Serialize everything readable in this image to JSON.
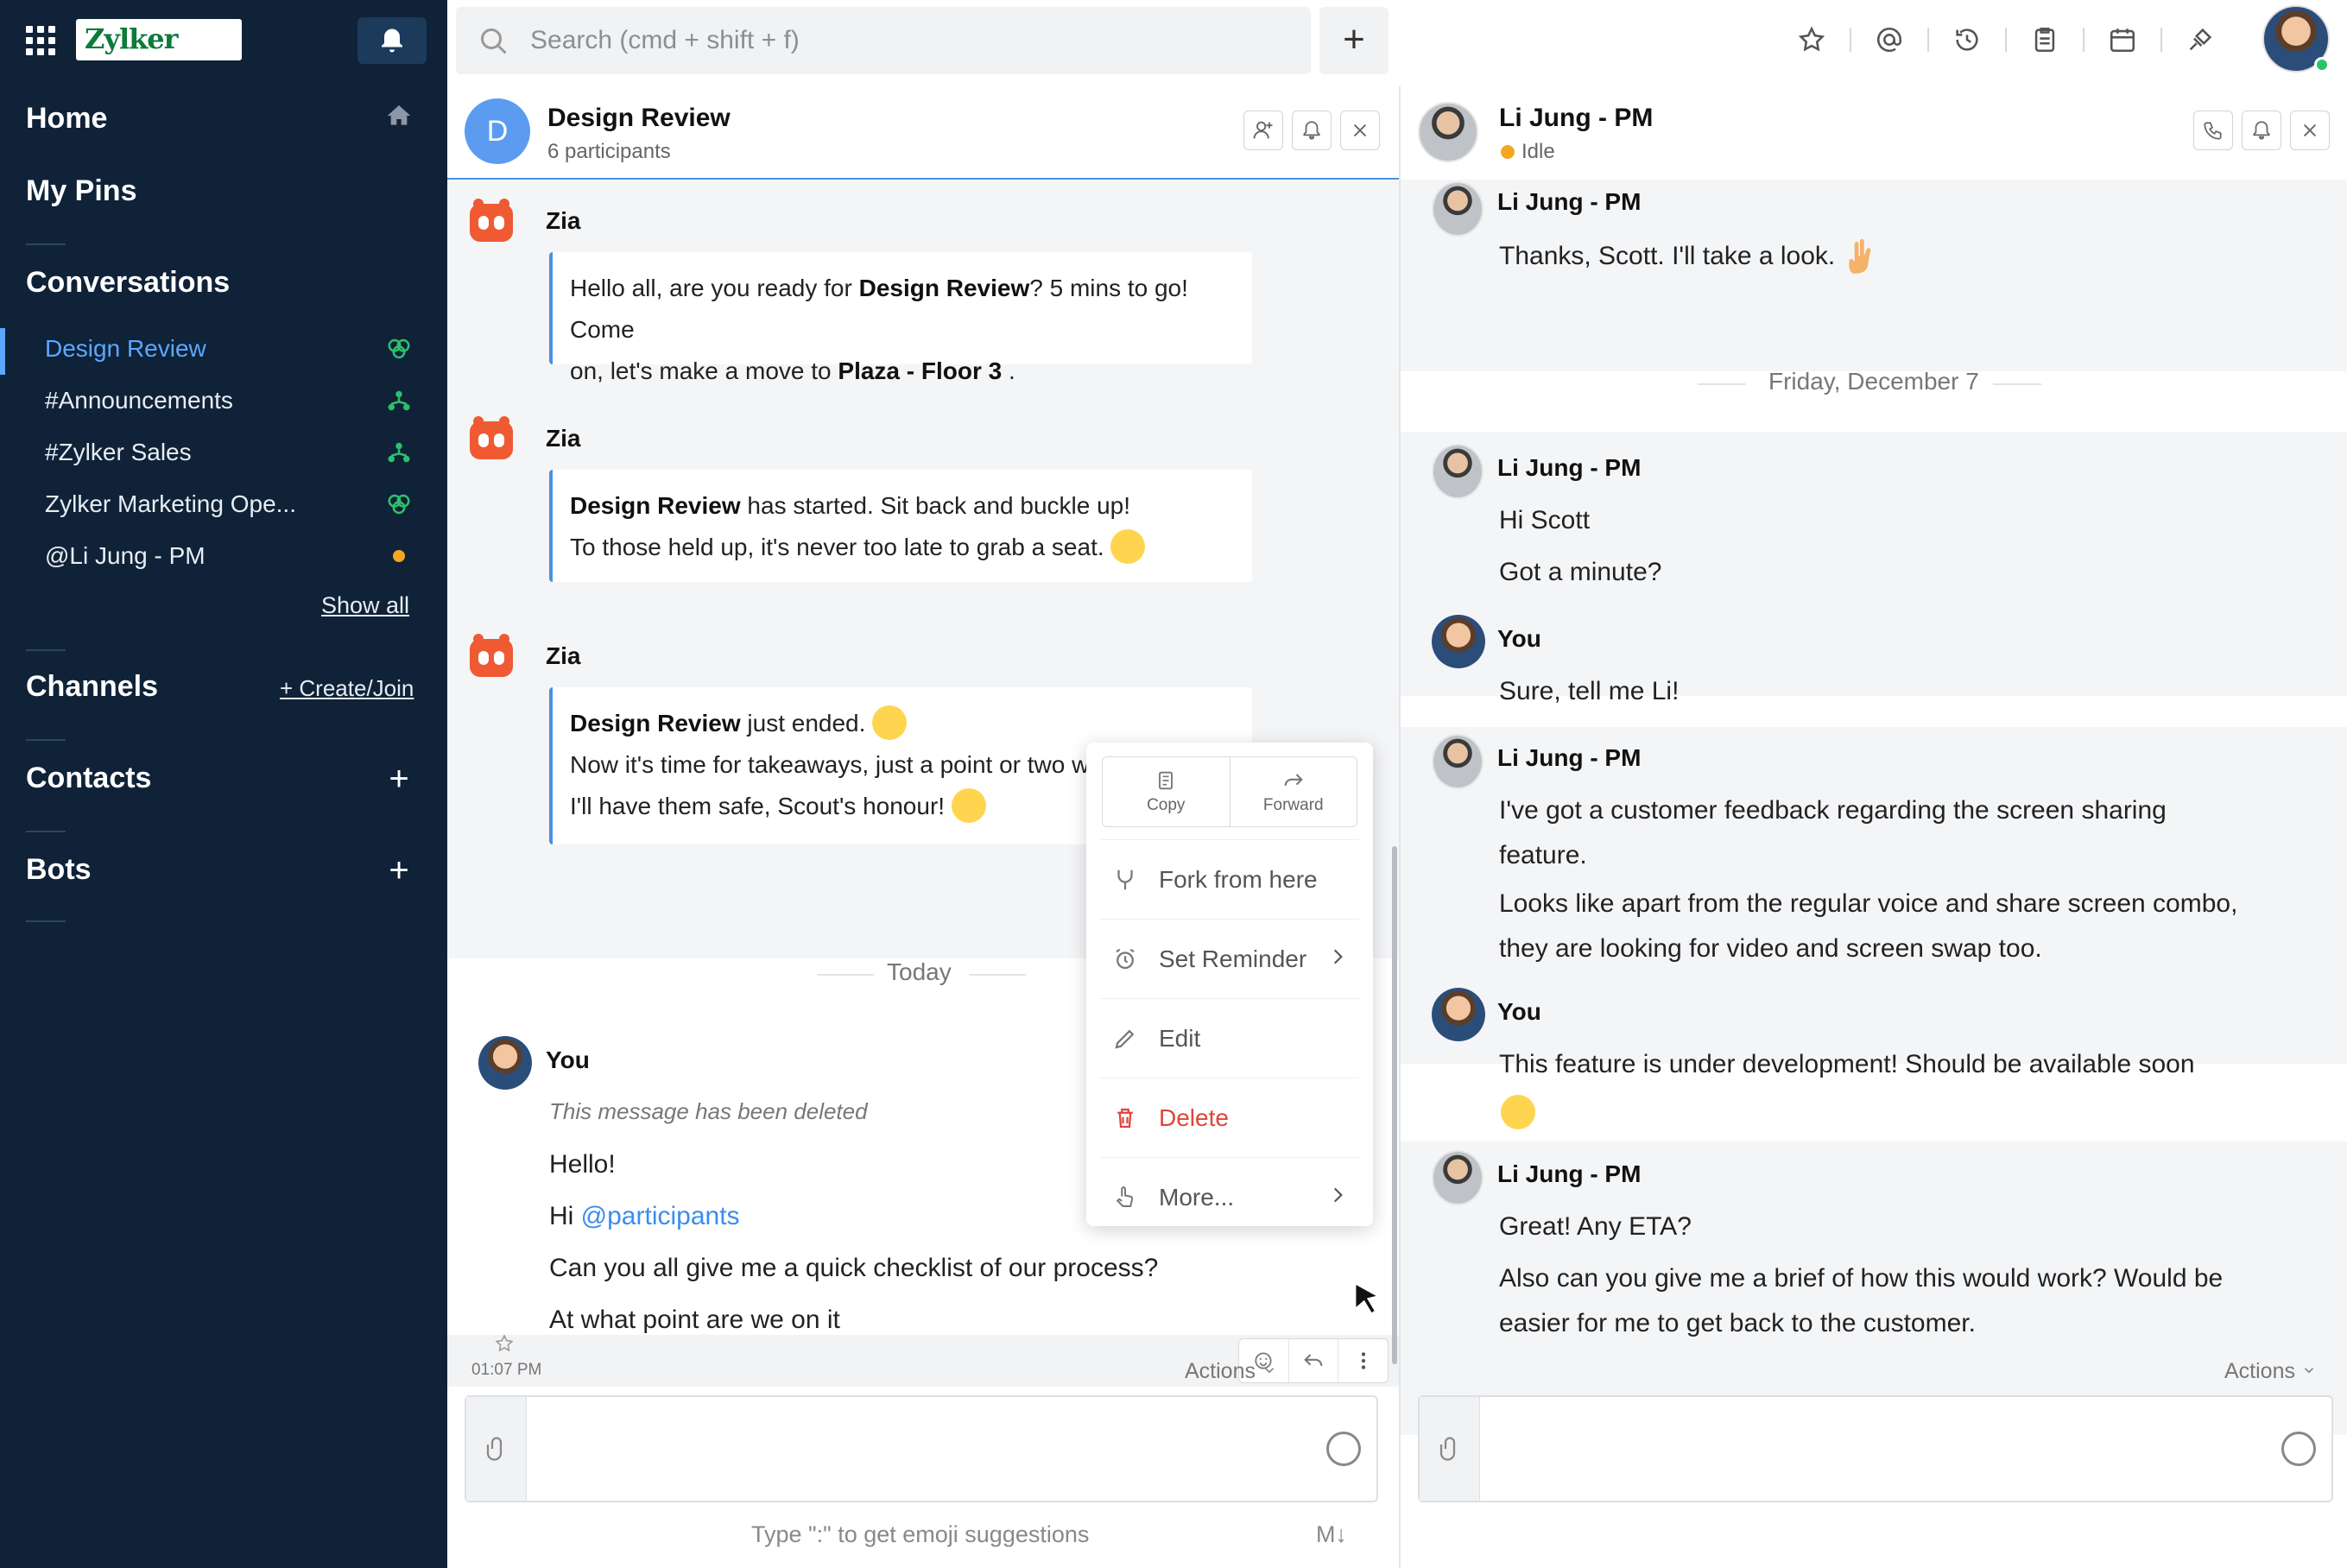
{
  "sidebar": {
    "logo": "Zylker",
    "home": "Home",
    "pins": "My Pins",
    "conversations": "Conversations",
    "items": [
      {
        "label": "Design Review"
      },
      {
        "label": "#Announcements"
      },
      {
        "label": "#Zylker Sales"
      },
      {
        "label": "Zylker Marketing Ope..."
      },
      {
        "label": "@Li Jung - PM"
      }
    ],
    "show_all": "Show all",
    "channels": "Channels",
    "create_join": "+ Create/Join",
    "contacts": "Contacts",
    "bots": "Bots"
  },
  "topbar": {
    "search_placeholder": "Search (cmd + shift + f)",
    "add": "+"
  },
  "left_chat": {
    "title": "Design Review",
    "subtitle": "6 participants",
    "avatar_letter": "D",
    "zia": "Zia",
    "msg1_a": "Hello all, are you ready for ",
    "msg1_b": "Design Review",
    "msg1_c": "? 5 mins to go! Come",
    "msg1_d": "on, let's make a move to ",
    "msg1_e": "Plaza - Floor 3",
    "msg1_f": " .",
    "msg2_a": "Design Review",
    "msg2_b": " has started. Sit back and buckle up!",
    "msg2_c": "To those held up, it's never too late to grab a seat.",
    "msg3_a": "Design Review",
    "msg3_b": " just ended.",
    "msg3_c": "Now it's time for takeaways, just a point or two wi",
    "msg3_d": "I'll have them safe, Scout's honour!",
    "today": "Today",
    "you": "You",
    "deleted": "This message has been deleted",
    "hello": "Hello!",
    "hi": "Hi ",
    "mention": "@participants",
    "checklist": "Can you all give me a quick checklist of our process?",
    "time": "01:07 PM",
    "at_what": "At what point are we on it",
    "actions": "Actions",
    "hint": "Type \":\" to get emoji suggestions",
    "markdown": "M↓"
  },
  "context_menu": {
    "copy": "Copy",
    "forward": "Forward",
    "fork": "Fork from here",
    "reminder": "Set Reminder",
    "edit": "Edit",
    "delete": "Delete",
    "more": "More..."
  },
  "right_chat": {
    "title": "Li Jung - PM",
    "status": "Idle",
    "li": "Li Jung - PM",
    "you": "You",
    "thanks": "Thanks, Scott. I'll take a look.",
    "date": "Friday, December 7",
    "hi_scott": "Hi Scott",
    "got_minute": "Got a minute?",
    "sure": "Sure, tell me Li!",
    "feedback1": "I've got a customer feedback regarding the screen sharing",
    "feedback2": "feature.",
    "feedback3": "Looks like apart from the regular voice and share screen combo,",
    "feedback4": "they are looking for video and screen swap too.",
    "dev": "This feature is under development! Should be available soon",
    "great": "Great! Any ETA?",
    "brief1": "Also can you give me a brief of how this would work? Would be",
    "brief2": "easier for me to get back to the customer.",
    "actions": "Actions"
  },
  "colors": {
    "sidebar_bg": "#0f2238",
    "accent": "#4a90e2",
    "delete": "#e0443a",
    "idle": "#f5a623",
    "online": "#2cc16b"
  }
}
